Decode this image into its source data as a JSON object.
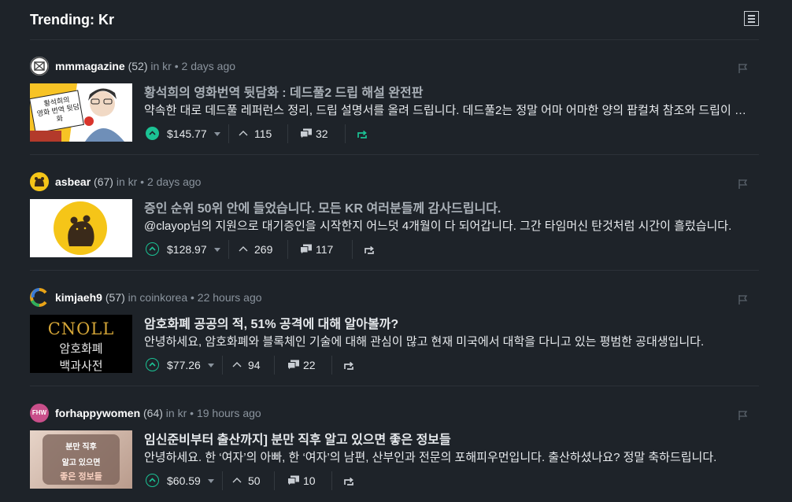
{
  "header": {
    "title": "Trending: Kr"
  },
  "posts": [
    {
      "author": "mmmagazine",
      "reputation": "(52)",
      "meta": " in kr • 2 days ago",
      "title": "황석희의 영화번역 뒷담화 : 데드풀2 드립 해설 완전판",
      "body": "약속한 대로 데드풀 레퍼런스 정리, 드립 설명서를 올려 드립니다. 데드풀2는 정말 어마 어마한 양의 팝컬쳐 참조와 드립이 있는데요.",
      "payout": "$145.77",
      "votes": "115",
      "comments": "32",
      "voted": true,
      "resteemed": true,
      "thumb_text": "황석희의\n영화 번역 뒷담화"
    },
    {
      "author": "asbear",
      "reputation": "(67)",
      "meta": " in kr • 2 days ago",
      "title": "증인 순위 50위 안에 들었습니다. 모든 KR 여러분들께 감사드립니다.",
      "body": "@clayop님의 지원으로 대기증인을 시작한지 어느덧 4개월이 다 되어갑니다. 그간 타임머신 탄것처럼 시간이 흘렀습니다.",
      "payout": "$128.97",
      "votes": "269",
      "comments": "117",
      "voted": false,
      "resteemed": false
    },
    {
      "author": "kimjaeh9",
      "reputation": "(57)",
      "meta": " in coinkorea • 22 hours ago",
      "title": "암호화폐 공공의 적, 51% 공격에 대해 알아볼까?",
      "body": "안녕하세요, 암호화폐와 블록체인 기술에 대해 관심이 많고 현재 미국에서 대학을 다니고 있는 평범한 공대생입니다.",
      "payout": "$77.26",
      "votes": "94",
      "comments": "22",
      "voted": false,
      "resteemed": false,
      "thumb_line1": "CNOLL",
      "thumb_line2": "암호화폐",
      "thumb_line3": "백과사전"
    },
    {
      "author": "forhappywomen",
      "reputation": "(64)",
      "meta": " in kr • 19 hours ago",
      "title": "임신준비부터 출산까지] 분만 직후 알고 있으면 좋은 정보들",
      "body": "안녕하세요. 한 ‘여자’의 아빠, 한 ‘여자’의 남편, 산부인과 전문의 포해피우먼입니다. 출산하셨나요? 정말 축하드립니다.",
      "payout": "$60.59",
      "votes": "50",
      "comments": "10",
      "voted": false,
      "resteemed": false,
      "avatar_text": "FHW",
      "thumb_line1": "분만 직후",
      "thumb_line2": "알고 있으면",
      "thumb_line3": "좋은 정보들"
    }
  ],
  "colors": {
    "accent": "#1bc294",
    "background": "#1e2329"
  }
}
